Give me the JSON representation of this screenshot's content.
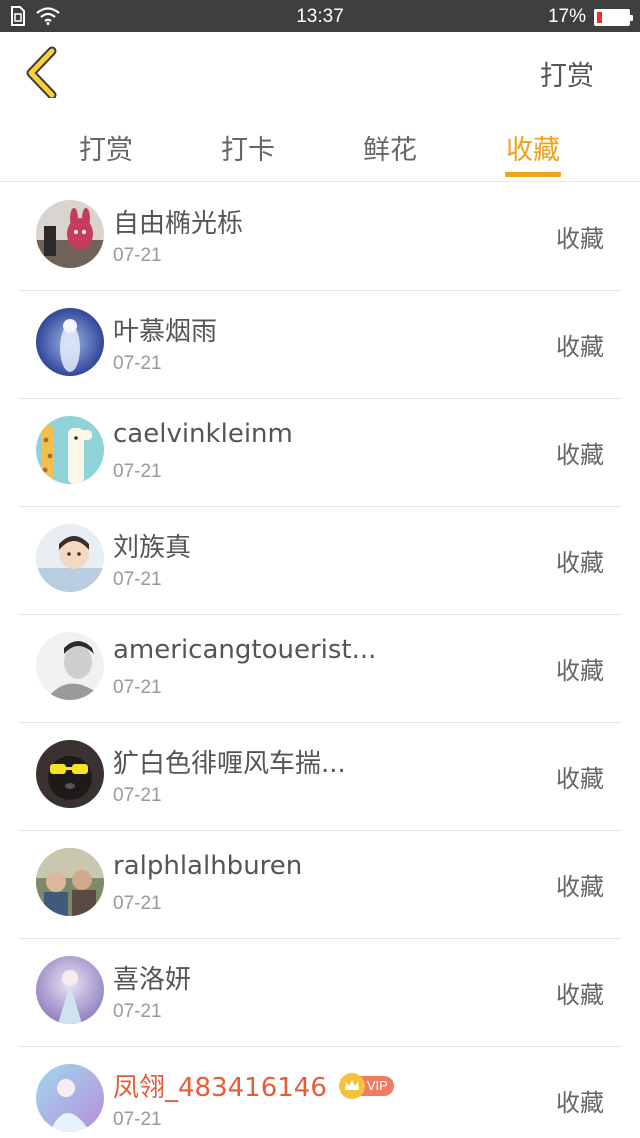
{
  "status_bar": {
    "time": "13:37",
    "battery_percent": "17%",
    "battery_level": 0.17,
    "battery_color": "#e8312a"
  },
  "header": {
    "action_label": "打赏"
  },
  "tabs": [
    {
      "label": "打赏",
      "active": false
    },
    {
      "label": "打卡",
      "active": false
    },
    {
      "label": "鲜花",
      "active": false
    },
    {
      "label": "收藏",
      "active": true
    }
  ],
  "accent_color": "#f0a21c",
  "list": {
    "items": [
      {
        "name": "自由椭光栎",
        "date": "07-21",
        "action": "收藏"
      },
      {
        "name": "叶慕烟雨",
        "date": "07-21",
        "action": "收藏"
      },
      {
        "name": "caelvinkleinm",
        "date": "07-21",
        "action": "收藏"
      },
      {
        "name": "刘族真",
        "date": "07-21",
        "action": "收藏"
      },
      {
        "name": "americangtouerist...",
        "date": "07-21",
        "action": "收藏"
      },
      {
        "name": "犷白色徘喱风车揣...",
        "date": "07-21",
        "action": "收藏"
      },
      {
        "name": "ralphlalhburen",
        "date": "07-21",
        "action": "收藏"
      },
      {
        "name": "喜洛妍",
        "date": "07-21",
        "action": "收藏"
      },
      {
        "name": "凤翎_483416146",
        "date": "07-21",
        "action": "收藏",
        "vip_label": "VIP"
      }
    ]
  }
}
